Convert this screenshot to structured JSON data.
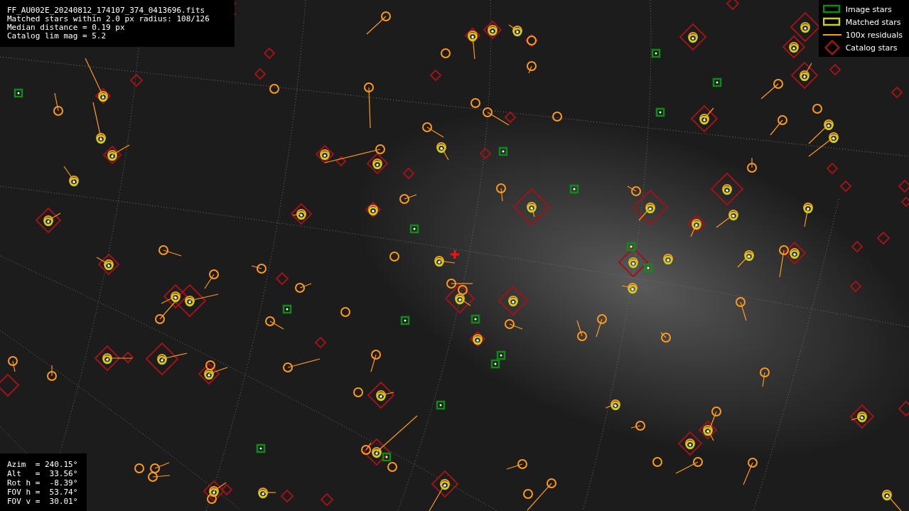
{
  "info_panel": {
    "lines": [
      "FF_AU002E_20240812_174107_374_0413696.fits",
      "Matched stars within 2.0 px radius: 108/126",
      "Median distance = 0.19 px",
      "Catalog lim mag = 5.2"
    ]
  },
  "legend": {
    "items": [
      {
        "kind": "image",
        "label": "Image stars",
        "color": "#0f8a16"
      },
      {
        "kind": "matched",
        "label": "Matched stars",
        "color": "#c8d21e"
      },
      {
        "kind": "residual",
        "label": "100x residuals",
        "color": "#ff9a1e"
      },
      {
        "kind": "catalog",
        "label": "Catalog stars",
        "color": "#9a1518"
      }
    ]
  },
  "pointing_panel": {
    "lines": [
      "Azim  = 240.15°",
      "Alt   =  33.56°",
      "Rot h =  -8.39°",
      "FOV h =  53.74°",
      "FOV v =  30.01°"
    ]
  }
}
